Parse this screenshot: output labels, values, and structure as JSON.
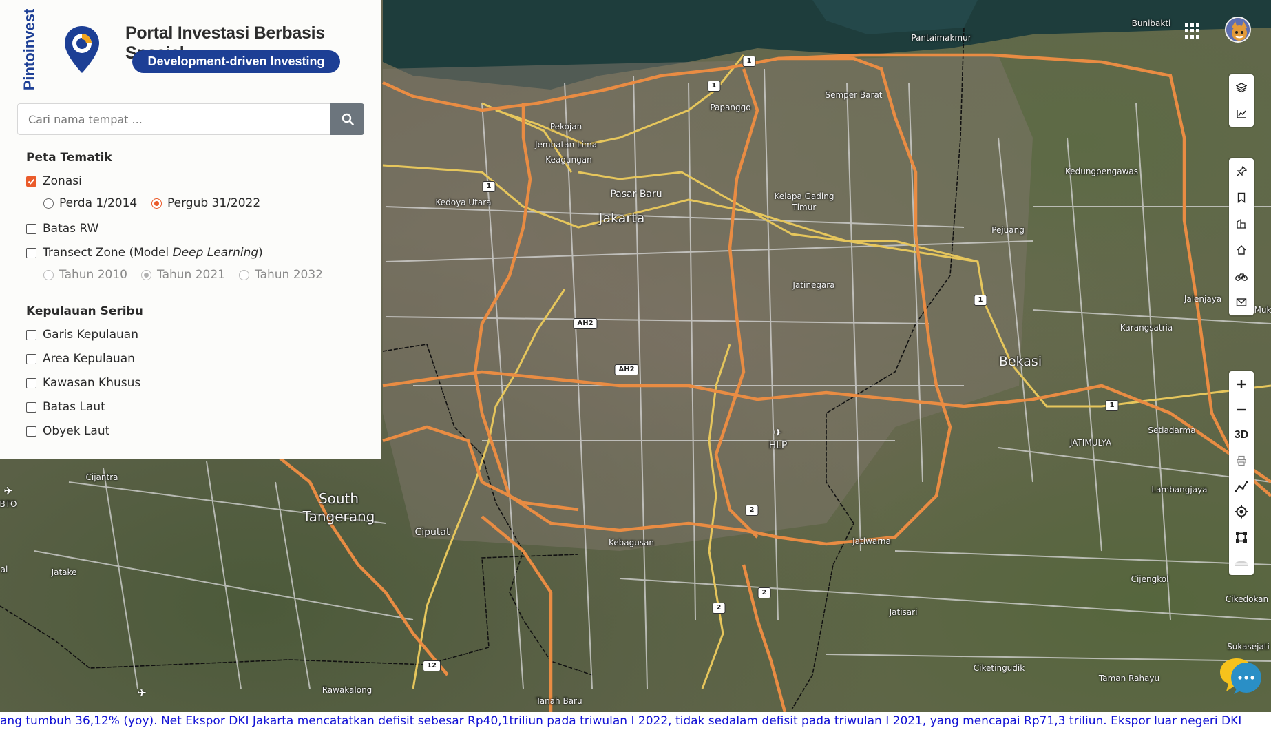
{
  "brand": {
    "vertical_name": "Pintoinvest",
    "portal_title": "Portal Investasi Berbasis Spasial",
    "tagline": "Development-driven Investing",
    "primary_color": "#1d3f95",
    "accent_color": "#ea5b2a"
  },
  "search": {
    "placeholder": "Cari nama tempat ...",
    "button_icon": "search-icon"
  },
  "peta_tematik": {
    "title": "Peta Tematik",
    "zonasi": {
      "label": "Zonasi",
      "checked": true,
      "options": [
        {
          "label": "Perda 1/2014",
          "selected": false
        },
        {
          "label": "Pergub 31/2022",
          "selected": true
        }
      ]
    },
    "batas_rw": {
      "label": "Batas RW",
      "checked": false
    },
    "transect": {
      "label_prefix": "Transect Zone (Model ",
      "label_italic": "Deep Learning",
      "label_suffix": ")",
      "checked": false,
      "options": [
        {
          "label": "Tahun 2010",
          "selected": false
        },
        {
          "label": "Tahun 2021",
          "selected": true
        },
        {
          "label": "Tahun 2032",
          "selected": false
        }
      ]
    }
  },
  "kepulauan_seribu": {
    "title": "Kepulauan Seribu",
    "items": [
      {
        "label": "Garis Kepulauan",
        "checked": false
      },
      {
        "label": "Area Kepulauan",
        "checked": false
      },
      {
        "label": "Kawasan Khusus",
        "checked": false
      },
      {
        "label": "Batas Laut",
        "checked": false
      },
      {
        "label": "Obyek Laut",
        "checked": false
      }
    ]
  },
  "map": {
    "places": {
      "jakarta": "Jakarta",
      "bekasi": "Bekasi",
      "south_tangerang_1": "South",
      "south_tangerang_2": "Tangerang",
      "bunibakti": "Bunibakti",
      "pantaimakmur": "Pantaimakmur",
      "semper_barat": "Semper Barat",
      "papanggo": "Papanggo",
      "pekojan": "Pekojan",
      "jembatan_lima": "Jembatan Lima",
      "keagungan": "Keagungan",
      "pasar_baru": "Pasar Baru",
      "kedoya_utara": "Kedoya Utara",
      "kelapa_gading_1": "Kelapa Gading",
      "kelapa_gading_2": "Timur",
      "kedungpengawas": "Kedungpengawas",
      "pejuang": "Pejuang",
      "jatinegara": "Jatinegara",
      "jalenjaya": "Jalenjaya",
      "muk": "Muk",
      "karangsatria": "Karangsatria",
      "jatimulya": "JATIMULYA",
      "setiadarma": "Setiadarma",
      "lambangjaya": "Lambangjaya",
      "hlp": "HLP",
      "cijantra": "Cijantra",
      "bto": "BTO",
      "al": "al",
      "ciputat": "Ciputat",
      "kebagusan": "Kebagusan",
      "jatiwarna": "Jatiwarna",
      "jatake": "Jatake",
      "cijengkol": "Cijengkol",
      "cikedokan": "Cikedokan",
      "jatisari": "Jatisari",
      "sukasejati": "Sukasejati",
      "rawakalong": "Rawakalong",
      "ciketingudik": "Ciketingudik",
      "taman_rahayu": "Taman Rahayu",
      "tanah_baru": "Tanah Baru"
    },
    "shields": {
      "s1a": "1",
      "s1b": "1",
      "s1c": "1",
      "s1d": "1",
      "s1e": "1",
      "ah2a": "AH2",
      "ah2b": "AH2",
      "s2a": "2",
      "s2b": "2",
      "s2c": "2",
      "s12": "12"
    }
  },
  "tools": {
    "top": [
      "layers-icon",
      "chart-icon"
    ],
    "middle": [
      "pin-icon",
      "bookmark-icon",
      "building-icon",
      "home-icon",
      "bicycle-icon",
      "mail-icon"
    ],
    "zoom": [
      "zoom-in-icon",
      "zoom-out-icon",
      "3d",
      "print-icon",
      "measure-icon",
      "locate-icon",
      "draw-area-icon",
      "road-icon"
    ],
    "label_3d": "3D"
  },
  "ticker": {
    "text": "ang tumbuh 36,12% (yoy). Net Ekspor DKI Jakarta mencatatkan defisit sebesar Rp40,1triliun pada triwulan I 2022, tidak sedalam defisit pada triwulan I 2021, yang mencapai Rp71,3 triliun. Ekspor luar negeri DKI"
  }
}
